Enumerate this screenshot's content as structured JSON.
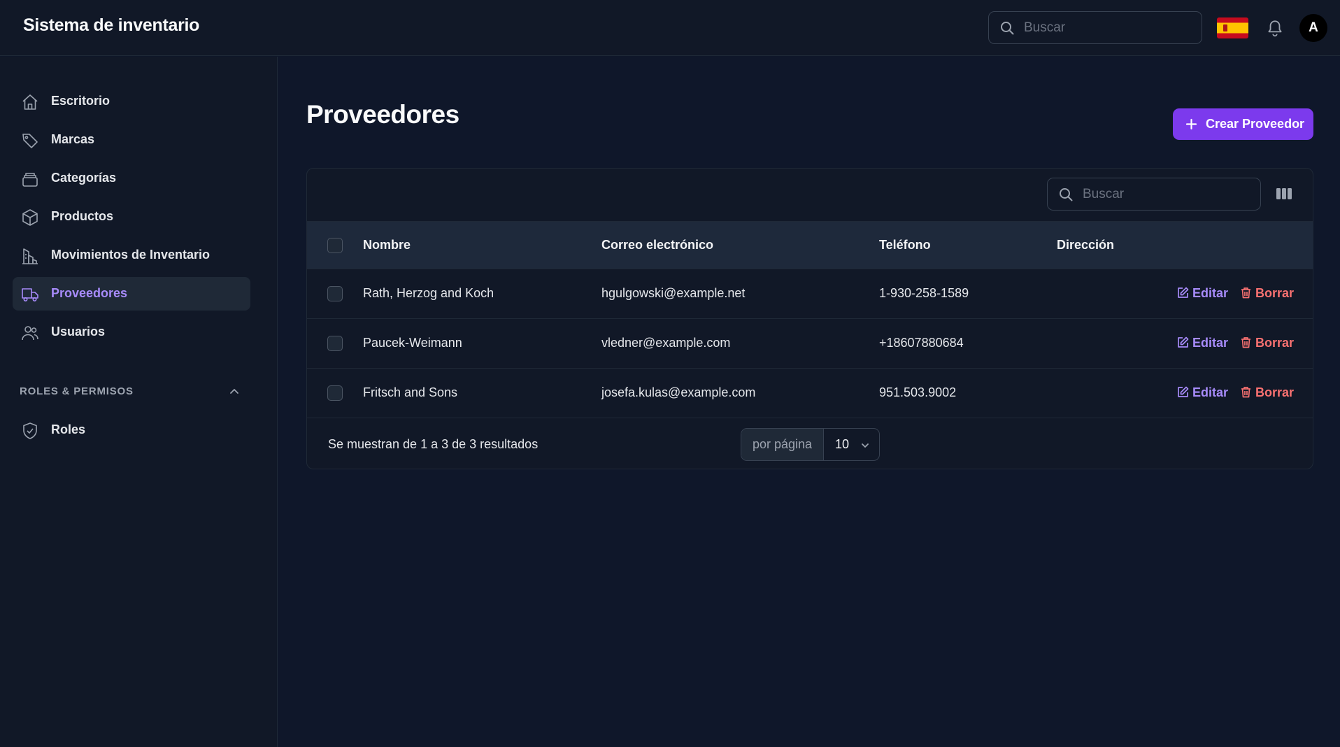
{
  "app": {
    "title": "Sistema de inventario"
  },
  "header": {
    "search_placeholder": "Buscar",
    "avatar_initial": "A"
  },
  "sidebar": {
    "items": [
      {
        "label": "Escritorio",
        "icon": "home-icon"
      },
      {
        "label": "Marcas",
        "icon": "tag-icon"
      },
      {
        "label": "Categorías",
        "icon": "layers-icon"
      },
      {
        "label": "Productos",
        "icon": "cube-icon"
      },
      {
        "label": "Movimientos de Inventario",
        "icon": "building-chart-icon"
      },
      {
        "label": "Proveedores",
        "icon": "truck-icon",
        "active": true
      },
      {
        "label": "Usuarios",
        "icon": "users-icon"
      }
    ],
    "group": {
      "label": "ROLES & PERMISOS",
      "items": [
        {
          "label": "Roles",
          "icon": "shield-check-icon"
        }
      ]
    }
  },
  "main": {
    "title": "Proveedores",
    "create_label": "Crear Proveedor",
    "table_search_placeholder": "Buscar",
    "columns": [
      "Nombre",
      "Correo electrónico",
      "Teléfono",
      "Dirección"
    ],
    "rows": [
      {
        "name": "Rath, Herzog and Koch",
        "email": "hgulgowski@example.net",
        "phone": "1-930-258-1589",
        "address": ""
      },
      {
        "name": "Paucek-Weimann",
        "email": "vledner@example.com",
        "phone": "+18607880684",
        "address": ""
      },
      {
        "name": "Fritsch and Sons",
        "email": "josefa.kulas@example.com",
        "phone": "951.503.9002",
        "address": ""
      }
    ],
    "edit_label": "Editar",
    "delete_label": "Borrar",
    "footer": {
      "results_text": "Se muestran de 1 a 3 de 3 resultados",
      "per_page_label": "por página",
      "per_page_value": "10"
    }
  },
  "colors": {
    "accent": "#7c3aed",
    "accent_text": "#a78bfa",
    "danger": "#f87171",
    "background": "#0f172a"
  }
}
